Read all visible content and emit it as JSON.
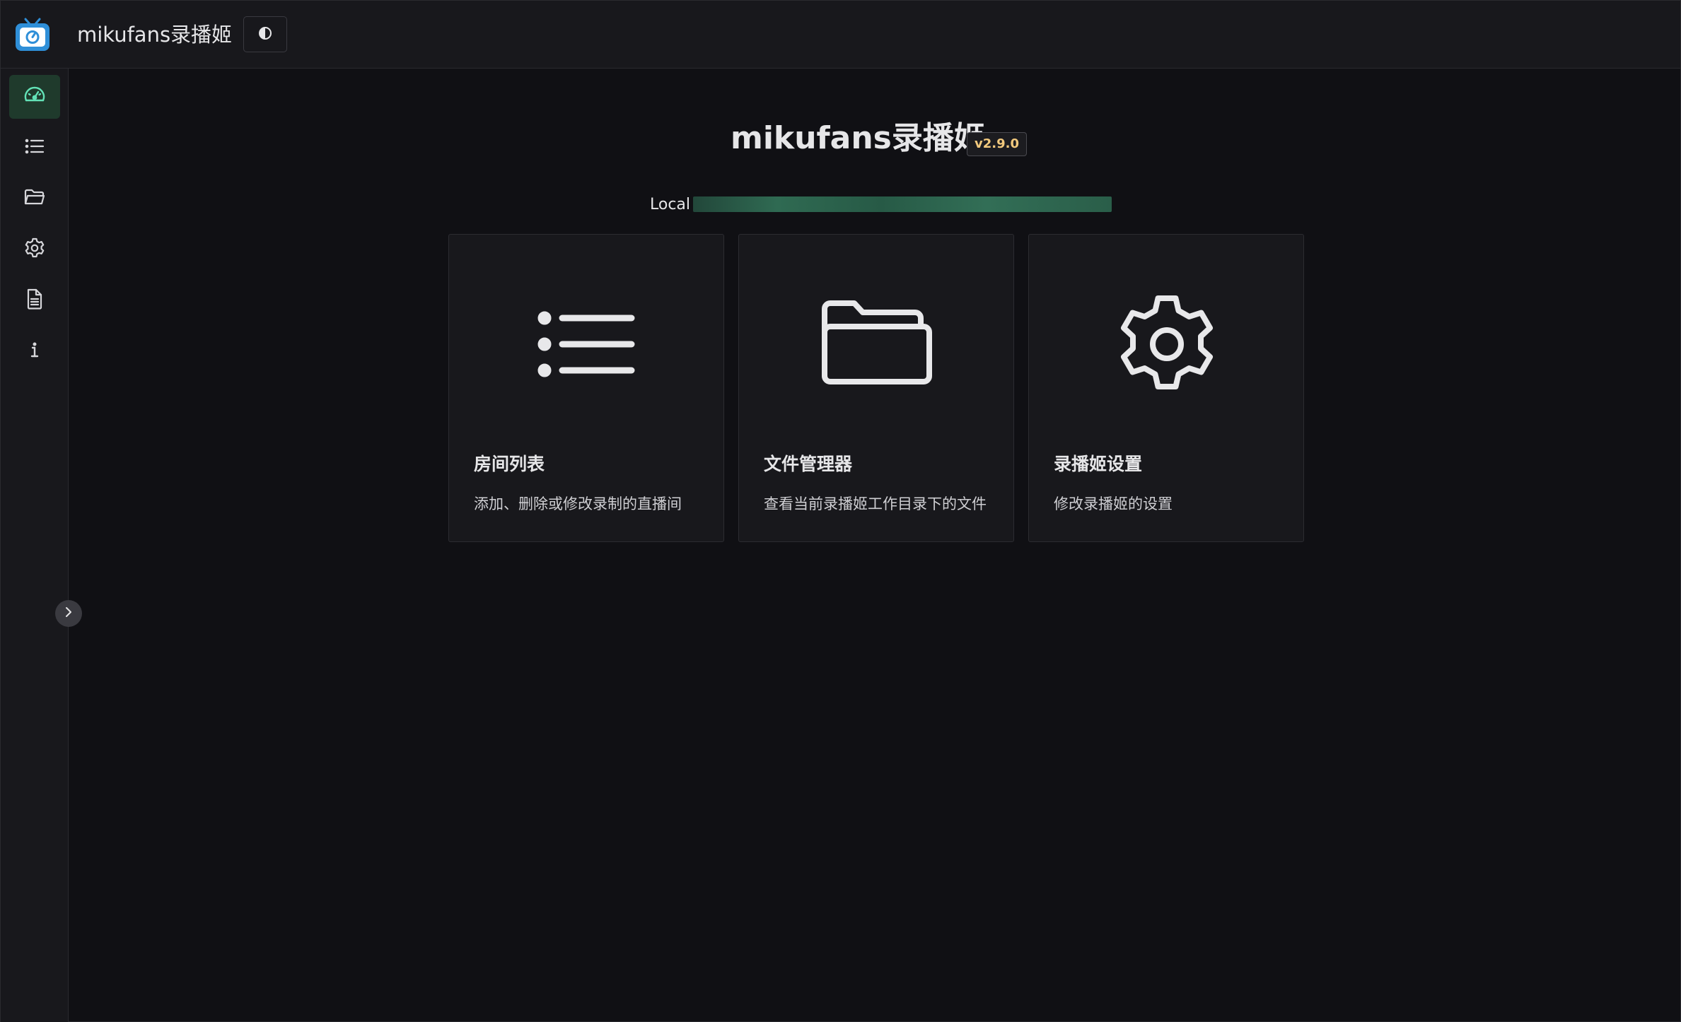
{
  "header": {
    "app_title": "mikufans录播姬",
    "logo_icon": "tv-logo-icon",
    "theme_toggle_icon": "contrast-icon"
  },
  "sidebar": {
    "items": [
      {
        "icon": "dashboard-icon",
        "active": true
      },
      {
        "icon": "list-icon",
        "active": false
      },
      {
        "icon": "folder-icon",
        "active": false
      },
      {
        "icon": "gear-icon",
        "active": false
      },
      {
        "icon": "document-icon",
        "active": false
      },
      {
        "icon": "info-icon",
        "active": false
      }
    ],
    "collapse_icon": "chevron-right-icon"
  },
  "main": {
    "title": "mikufans录播姬",
    "version": "v2.9.0",
    "local_label": "Local",
    "local_value": "",
    "cards": [
      {
        "icon": "list-icon",
        "title": "房间列表",
        "desc": "添加、删除或修改录制的直播间"
      },
      {
        "icon": "folder-icon",
        "title": "文件管理器",
        "desc": "查看当前录播姬工作目录下的文件"
      },
      {
        "icon": "gear-icon",
        "title": "录播姬设置",
        "desc": "修改录播姬的设置"
      }
    ]
  },
  "colors": {
    "background": "#101014",
    "panel": "#18181c",
    "accent": "#63e2b7",
    "active_bg": "#1f3a2c",
    "version_text": "#f2c97d"
  }
}
